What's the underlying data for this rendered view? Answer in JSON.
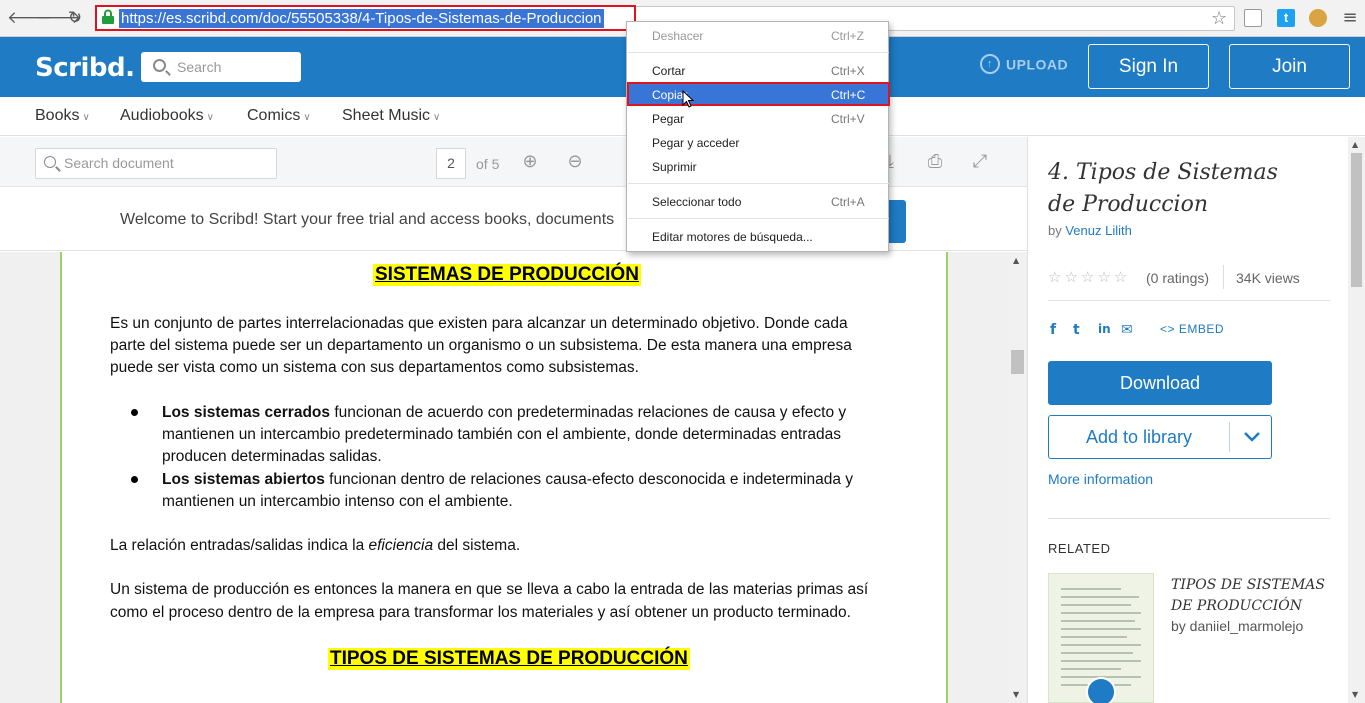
{
  "browser": {
    "url": "https://es.scribd.com/doc/55505338/4-Tipos-de-Sistemas-de-Produccion",
    "back_glyph": "🡐",
    "forward_glyph": "🡒",
    "reload_glyph": "↻",
    "menu_glyph": "≡",
    "star_glyph": "☆",
    "extension_icons": [
      "reader-icon",
      "twitter-icon",
      "extension-icon"
    ]
  },
  "scribd_header": {
    "logo": "Scribd.",
    "search_placeholder": "Search",
    "upload_label": "UPLOAD",
    "signin_label": "Sign In",
    "join_label": "Join",
    "brand_color": "#1e7bc4"
  },
  "categories": [
    {
      "label": "Books"
    },
    {
      "label": "Audiobooks"
    },
    {
      "label": "Comics"
    },
    {
      "label": "Sheet Music"
    }
  ],
  "doc_toolbar": {
    "search_placeholder": "Search document",
    "page_current": "2",
    "page_of": "of 5"
  },
  "welcome": {
    "text": "Welcome to Scribd! Start your free trial and access books, documents"
  },
  "document": {
    "heading1": "SISTEMAS DE PRODUCCIÓN",
    "para1_line1": "Es un conjunto de partes interrelacionadas que existen para alcanzar un determinado objetivo. Donde cada",
    "para1_line2": "parte del sistema puede ser un departamento un organismo o un subsistema. De esta manera una empresa",
    "para1_line3": "puede ser vista como un sistema con sus departamentos como subsistemas.",
    "b1_bold": "Los sistemas cerrados",
    "b1_line1_rest": " funcionan de acuerdo con predeterminadas relaciones de causa y efecto y",
    "b1_line2": "mantienen un intercambio predeterminado también con el ambiente, donde determinadas entradas",
    "b1_line3": "producen determinadas salidas.",
    "b2_bold": "Los sistemas abiertos",
    "b2_line1_rest": " funcionan dentro de relaciones causa-efecto desconocida e indeterminada y",
    "b2_line2": "mantienen un intercambio intenso con el ambiente.",
    "para2_pre": "La relación entradas/salidas indica la ",
    "para2_italic": "eficiencia",
    "para2_post": " del sistema.",
    "para3_line1": "Un sistema de producción es entonces la manera en que se lleva a cabo la entrada de las materias primas así",
    "para3_line2": "como el proceso dentro de la empresa para transformar los materiales y así obtener un producto terminado.",
    "heading2": "TIPOS DE SISTEMAS DE PRODUCCIÓN"
  },
  "sidebar": {
    "title": "4. Tipos de Sistemas de Produccion",
    "by_prefix": "by ",
    "author": "Venuz Lilith",
    "stars": "☆☆☆☆☆",
    "ratings": "(0 ratings)",
    "views": "34K views",
    "embed_label": "EMBED",
    "download_label": "Download",
    "add_library_label": "Add to library",
    "more_info_label": "More information",
    "related_label": "RELATED",
    "related_title": "TIPOS DE SISTEMAS DE PRODUCCIÓN",
    "related_by": "by daniiel_marmolejo"
  },
  "context_menu": {
    "items": [
      {
        "label": "Deshacer",
        "shortcut": "Ctrl+Z",
        "state": "disabled"
      },
      {
        "label": "Cortar",
        "shortcut": "Ctrl+X",
        "state": "normal"
      },
      {
        "label": "Copiar",
        "shortcut": "Ctrl+C",
        "state": "selected"
      },
      {
        "label": "Pegar",
        "shortcut": "Ctrl+V",
        "state": "normal"
      },
      {
        "label": "Pegar y acceder",
        "shortcut": "",
        "state": "normal"
      },
      {
        "label": "Suprimir",
        "shortcut": "",
        "state": "normal"
      },
      {
        "label": "Seleccionar todo",
        "shortcut": "Ctrl+A",
        "state": "normal"
      },
      {
        "label": "Editar motores de búsqueda...",
        "shortcut": "",
        "state": "normal"
      }
    ]
  }
}
